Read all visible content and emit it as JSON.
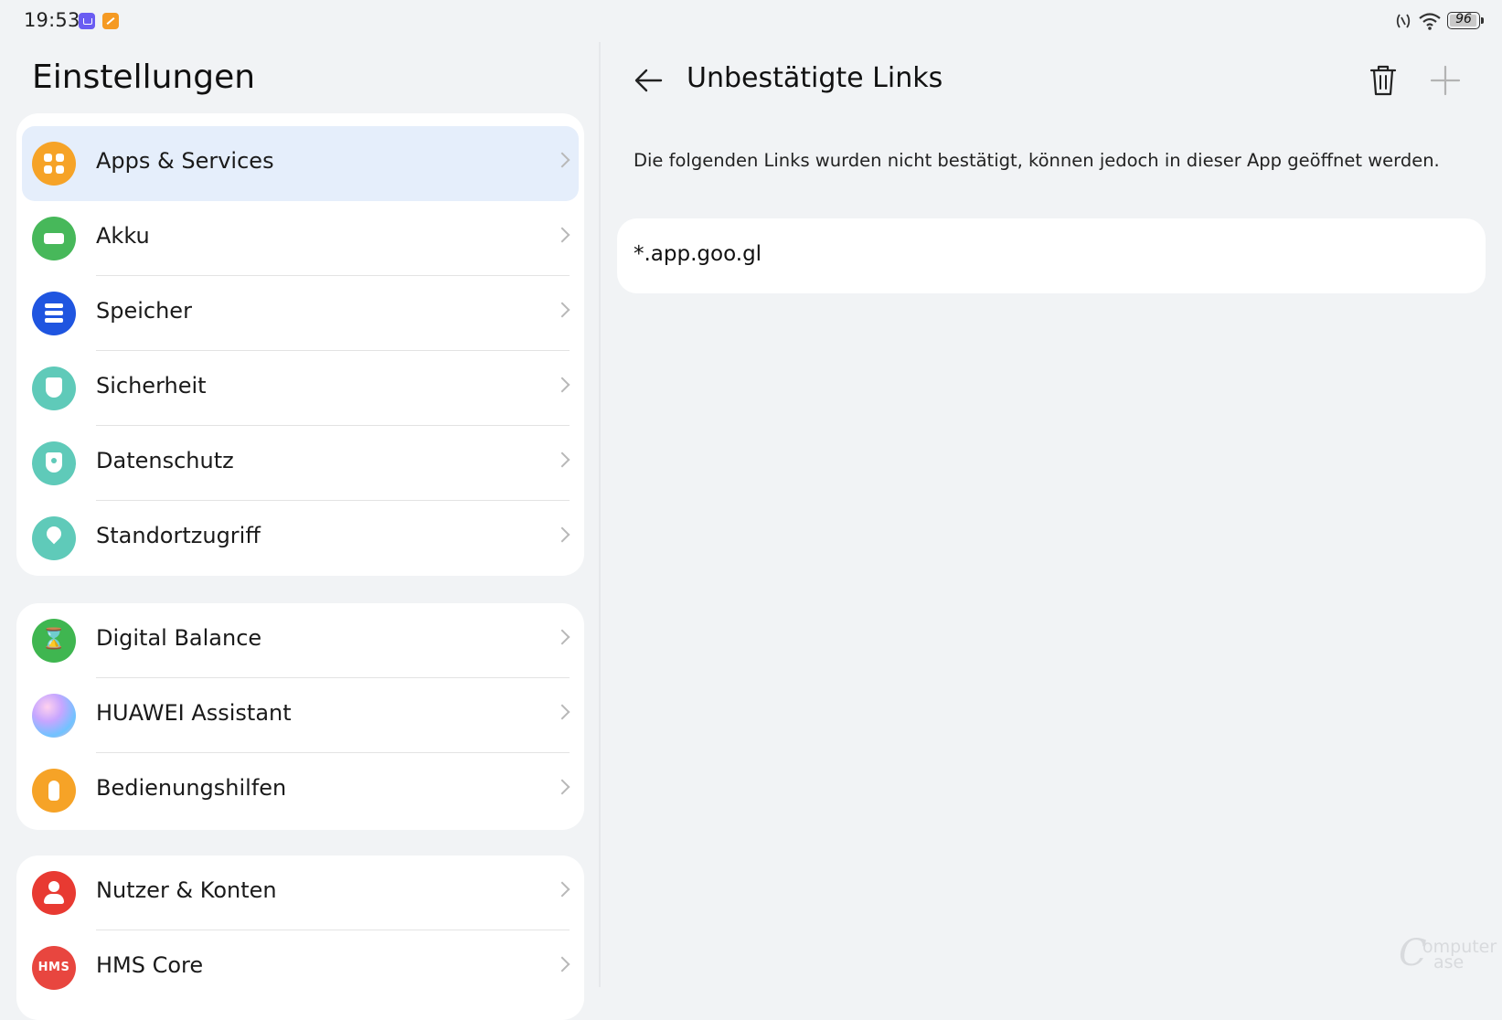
{
  "status_bar": {
    "time": "19:53",
    "battery_level": "96",
    "battery_fraction": 0.96,
    "icons": [
      "app-notification-icon",
      "app-notification-icon",
      "nfc-icon",
      "wifi-icon",
      "battery-icon"
    ]
  },
  "left": {
    "title": "Einstellungen",
    "groups": [
      [
        {
          "label": "Apps & Services",
          "icon": "apps-icon",
          "selected": true
        },
        {
          "label": "Akku",
          "icon": "battery-icon"
        },
        {
          "label": "Speicher",
          "icon": "storage-icon"
        },
        {
          "label": "Sicherheit",
          "icon": "shield-check-icon"
        },
        {
          "label": "Datenschutz",
          "icon": "privacy-shield-icon"
        },
        {
          "label": "Standortzugriff",
          "icon": "location-pin-icon"
        }
      ],
      [
        {
          "label": "Digital Balance",
          "icon": "hourglass-icon"
        },
        {
          "label": "HUAWEI Assistant",
          "icon": "assistant-orb-icon"
        },
        {
          "label": "Bedienungshilfen",
          "icon": "accessibility-hand-icon"
        }
      ],
      [
        {
          "label": "Nutzer & Konten",
          "icon": "user-icon"
        },
        {
          "label": "HMS Core",
          "icon": "hms-icon",
          "icon_text": "HMS"
        }
      ]
    ]
  },
  "right": {
    "title": "Unbestätigte Links",
    "description": "Die folgenden Links wurden nicht bestätigt, können jedoch in dieser App geöffnet werden.",
    "links": [
      "*.app.goo.gl"
    ]
  },
  "watermark": {
    "line1": "omputer",
    "line2": "ase"
  },
  "colors": {
    "background": "#f1f3f5",
    "card": "#ffffff",
    "selected_row": "#e5eefb",
    "apps_icon": "#f6a327",
    "battery_icon": "#47b85a",
    "storage_icon": "#1f55e0",
    "teal_icon": "#5fcab9",
    "account_icon": "#e83a32"
  }
}
